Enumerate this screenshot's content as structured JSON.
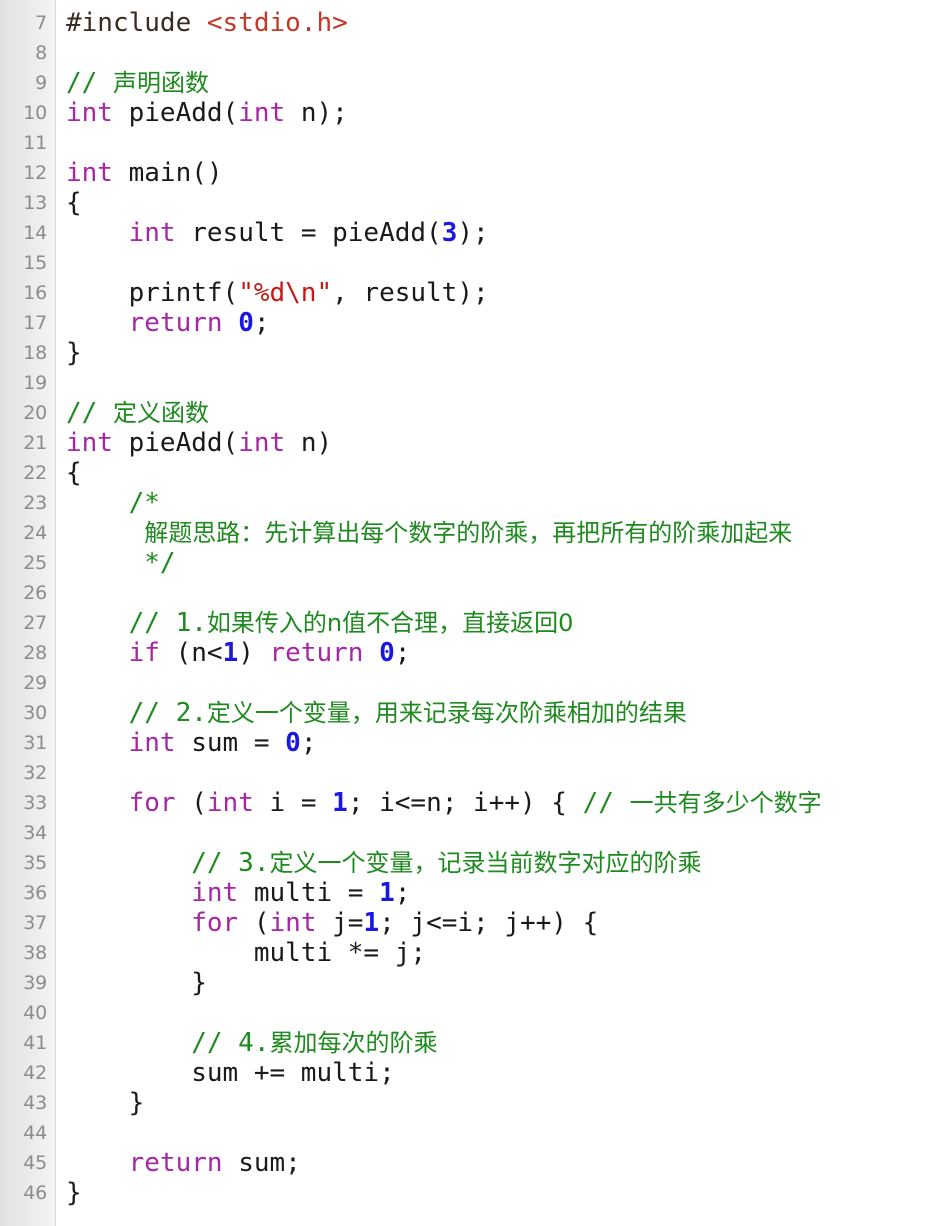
{
  "editor": {
    "language": "c",
    "first_line_number": 7,
    "last_line_number": 46,
    "colors": {
      "background": "#ffffff",
      "gutter_background": "#e9e9e9",
      "gutter_text": "#8c8c8c",
      "keyword": "#a626a4",
      "number": "#1a17e0",
      "string": "#c41a16",
      "comment": "#1f8a1f",
      "preprocessor": "#3a2a22",
      "header": "#c0392b",
      "plain_text": "#1a1a1a"
    }
  },
  "gutter": {
    "numbers": [
      "7",
      "8",
      "9",
      "10",
      "11",
      "12",
      "13",
      "14",
      "15",
      "16",
      "17",
      "18",
      "19",
      "20",
      "21",
      "22",
      "23",
      "24",
      "25",
      "26",
      "27",
      "28",
      "29",
      "30",
      "31",
      "32",
      "33",
      "34",
      "35",
      "36",
      "37",
      "38",
      "39",
      "40",
      "41",
      "42",
      "43",
      "44",
      "45",
      "46"
    ]
  },
  "code": {
    "lines": [
      {
        "n": "7",
        "tokens": [
          {
            "t": "#include ",
            "c": "pre"
          },
          {
            "t": "<stdio.h>",
            "c": "hdr"
          }
        ]
      },
      {
        "n": "8",
        "tokens": []
      },
      {
        "n": "9",
        "tokens": [
          {
            "t": "// ",
            "c": "cmt"
          },
          {
            "t": "声明函数",
            "c": "cmt cjk"
          }
        ]
      },
      {
        "n": "10",
        "tokens": [
          {
            "t": "int",
            "c": "kw"
          },
          {
            "t": " pieAdd(",
            "c": "fn"
          },
          {
            "t": "int",
            "c": "kw"
          },
          {
            "t": " n);",
            "c": "fn"
          }
        ]
      },
      {
        "n": "11",
        "tokens": []
      },
      {
        "n": "12",
        "tokens": [
          {
            "t": "int",
            "c": "kw"
          },
          {
            "t": " main()",
            "c": "fn"
          }
        ]
      },
      {
        "n": "13",
        "tokens": [
          {
            "t": "{",
            "c": "fn"
          }
        ]
      },
      {
        "n": "14",
        "tokens": [
          {
            "t": "    ",
            "c": "fn"
          },
          {
            "t": "int",
            "c": "kw"
          },
          {
            "t": " result = pieAdd(",
            "c": "fn"
          },
          {
            "t": "3",
            "c": "num"
          },
          {
            "t": ");",
            "c": "fn"
          }
        ]
      },
      {
        "n": "15",
        "tokens": []
      },
      {
        "n": "16",
        "tokens": [
          {
            "t": "    printf(",
            "c": "fn"
          },
          {
            "t": "\"%d\\n\"",
            "c": "str"
          },
          {
            "t": ", result);",
            "c": "fn"
          }
        ]
      },
      {
        "n": "17",
        "tokens": [
          {
            "t": "    ",
            "c": "fn"
          },
          {
            "t": "return",
            "c": "kw"
          },
          {
            "t": " ",
            "c": "fn"
          },
          {
            "t": "0",
            "c": "num"
          },
          {
            "t": ";",
            "c": "fn"
          }
        ]
      },
      {
        "n": "18",
        "tokens": [
          {
            "t": "}",
            "c": "fn"
          }
        ]
      },
      {
        "n": "19",
        "tokens": []
      },
      {
        "n": "20",
        "tokens": [
          {
            "t": "// ",
            "c": "cmt"
          },
          {
            "t": "定义函数",
            "c": "cmt cjk"
          }
        ]
      },
      {
        "n": "21",
        "tokens": [
          {
            "t": "int",
            "c": "kw"
          },
          {
            "t": " pieAdd(",
            "c": "fn"
          },
          {
            "t": "int",
            "c": "kw"
          },
          {
            "t": " n)",
            "c": "fn"
          }
        ]
      },
      {
        "n": "22",
        "tokens": [
          {
            "t": "{",
            "c": "fn"
          }
        ]
      },
      {
        "n": "23",
        "tokens": [
          {
            "t": "    /*",
            "c": "cmt"
          }
        ]
      },
      {
        "n": "24",
        "tokens": [
          {
            "t": "     ",
            "c": "cmt"
          },
          {
            "t": "解题思路：先计算出每个数字的阶乘，再把所有的阶乘加起来",
            "c": "cmt cjk"
          }
        ]
      },
      {
        "n": "25",
        "tokens": [
          {
            "t": "     */",
            "c": "cmt"
          }
        ]
      },
      {
        "n": "26",
        "tokens": []
      },
      {
        "n": "27",
        "tokens": [
          {
            "t": "    // 1.",
            "c": "cmt"
          },
          {
            "t": "如果传入的n值不合理，直接返回0",
            "c": "cmt cjk"
          }
        ]
      },
      {
        "n": "28",
        "tokens": [
          {
            "t": "    ",
            "c": "fn"
          },
          {
            "t": "if",
            "c": "kw"
          },
          {
            "t": " (n<",
            "c": "fn"
          },
          {
            "t": "1",
            "c": "num"
          },
          {
            "t": ") ",
            "c": "fn"
          },
          {
            "t": "return",
            "c": "kw"
          },
          {
            "t": " ",
            "c": "fn"
          },
          {
            "t": "0",
            "c": "num"
          },
          {
            "t": ";",
            "c": "fn"
          }
        ]
      },
      {
        "n": "29",
        "tokens": []
      },
      {
        "n": "30",
        "tokens": [
          {
            "t": "    // 2.",
            "c": "cmt"
          },
          {
            "t": "定义一个变量，用来记录每次阶乘相加的结果",
            "c": "cmt cjk"
          }
        ]
      },
      {
        "n": "31",
        "tokens": [
          {
            "t": "    ",
            "c": "fn"
          },
          {
            "t": "int",
            "c": "kw"
          },
          {
            "t": " sum = ",
            "c": "fn"
          },
          {
            "t": "0",
            "c": "num"
          },
          {
            "t": ";",
            "c": "fn"
          }
        ]
      },
      {
        "n": "32",
        "tokens": []
      },
      {
        "n": "33",
        "tokens": [
          {
            "t": "    ",
            "c": "fn"
          },
          {
            "t": "for",
            "c": "kw"
          },
          {
            "t": " (",
            "c": "fn"
          },
          {
            "t": "int",
            "c": "kw"
          },
          {
            "t": " i = ",
            "c": "fn"
          },
          {
            "t": "1",
            "c": "num"
          },
          {
            "t": "; i<=n; i++) { ",
            "c": "fn"
          },
          {
            "t": "// ",
            "c": "cmt"
          },
          {
            "t": "一共有多少个数字",
            "c": "cmt cjk"
          }
        ]
      },
      {
        "n": "34",
        "tokens": []
      },
      {
        "n": "35",
        "tokens": [
          {
            "t": "        // 3.",
            "c": "cmt"
          },
          {
            "t": "定义一个变量，记录当前数字对应的阶乘",
            "c": "cmt cjk"
          }
        ]
      },
      {
        "n": "36",
        "tokens": [
          {
            "t": "        ",
            "c": "fn"
          },
          {
            "t": "int",
            "c": "kw"
          },
          {
            "t": " multi = ",
            "c": "fn"
          },
          {
            "t": "1",
            "c": "num"
          },
          {
            "t": ";",
            "c": "fn"
          }
        ]
      },
      {
        "n": "37",
        "tokens": [
          {
            "t": "        ",
            "c": "fn"
          },
          {
            "t": "for",
            "c": "kw"
          },
          {
            "t": " (",
            "c": "fn"
          },
          {
            "t": "int",
            "c": "kw"
          },
          {
            "t": " j=",
            "c": "fn"
          },
          {
            "t": "1",
            "c": "num"
          },
          {
            "t": "; j<=i; j++) {",
            "c": "fn"
          }
        ]
      },
      {
        "n": "38",
        "tokens": [
          {
            "t": "            multi *= j;",
            "c": "fn"
          }
        ]
      },
      {
        "n": "39",
        "tokens": [
          {
            "t": "        }",
            "c": "fn"
          }
        ]
      },
      {
        "n": "40",
        "tokens": []
      },
      {
        "n": "41",
        "tokens": [
          {
            "t": "        // 4.",
            "c": "cmt"
          },
          {
            "t": "累加每次的阶乘",
            "c": "cmt cjk"
          }
        ]
      },
      {
        "n": "42",
        "tokens": [
          {
            "t": "        sum += multi;",
            "c": "fn"
          }
        ]
      },
      {
        "n": "43",
        "tokens": [
          {
            "t": "    }",
            "c": "fn"
          }
        ]
      },
      {
        "n": "44",
        "tokens": []
      },
      {
        "n": "45",
        "tokens": [
          {
            "t": "    ",
            "c": "fn"
          },
          {
            "t": "return",
            "c": "kw"
          },
          {
            "t": " sum;",
            "c": "fn"
          }
        ]
      },
      {
        "n": "46",
        "tokens": [
          {
            "t": "}",
            "c": "fn"
          }
        ]
      }
    ]
  }
}
